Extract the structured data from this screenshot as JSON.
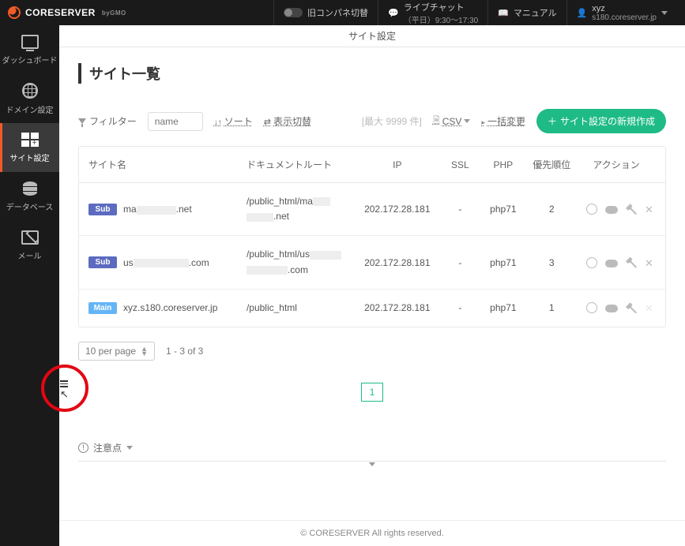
{
  "brand": {
    "name": "CORESERVER",
    "sub": "byGMO"
  },
  "topbar": {
    "old_panel": "旧コンパネ切替",
    "chat": {
      "label": "ライブチャット",
      "hours": "（平日）9:30～17:30"
    },
    "manual": "マニュアル",
    "account": {
      "user": "xyz",
      "host": "s180.coreserver.jp"
    }
  },
  "breadcrumb": "サイト設定",
  "sidebar": {
    "items": [
      {
        "label": "ダッシュボード"
      },
      {
        "label": "ドメイン設定"
      },
      {
        "label": "サイト設定"
      },
      {
        "label": "データベース"
      },
      {
        "label": "メール"
      }
    ]
  },
  "page": {
    "title": "サイト一覧"
  },
  "toolbar": {
    "filter_label": "フィルター",
    "name_placeholder": "name",
    "sort": "ソート",
    "display_toggle": "表示切替",
    "max_hint": "[最大 9999 件]",
    "csv": "CSV",
    "bulk": "一括変更",
    "create_btn": "サイト設定の新規作成"
  },
  "table": {
    "headers": {
      "site": "サイト名",
      "docroot": "ドキュメントルート",
      "ip": "IP",
      "ssl": "SSL",
      "php": "PHP",
      "priority": "優先順位",
      "actions": "アクション"
    },
    "rows": [
      {
        "badge": "Sub",
        "badge_class": "badge-sub",
        "name_pre": "ma",
        "name_post": ".net",
        "doc_pre": "/public_html/ma",
        "doc_post": ".net",
        "ip": "202.172.28.181",
        "ssl": "-",
        "php": "php71",
        "priority": "2"
      },
      {
        "badge": "Sub",
        "badge_class": "badge-sub",
        "name_pre": "us",
        "name_post": ".com",
        "doc_pre": "/public_html/us",
        "doc_post": ".com",
        "ip": "202.172.28.181",
        "ssl": "-",
        "php": "php71",
        "priority": "3"
      },
      {
        "badge": "Main",
        "badge_class": "badge-main",
        "name_pre": "xyz.s180.coreserver.jp",
        "name_post": "",
        "doc_pre": "/public_html",
        "doc_post": "",
        "ip": "202.172.28.181",
        "ssl": "-",
        "php": "php71",
        "priority": "1"
      }
    ]
  },
  "pager": {
    "per_page": "10 per page",
    "range": "1 - 3 of 3",
    "current": "1"
  },
  "attention": "注意点",
  "footer": "© CORESERVER All rights reserved."
}
